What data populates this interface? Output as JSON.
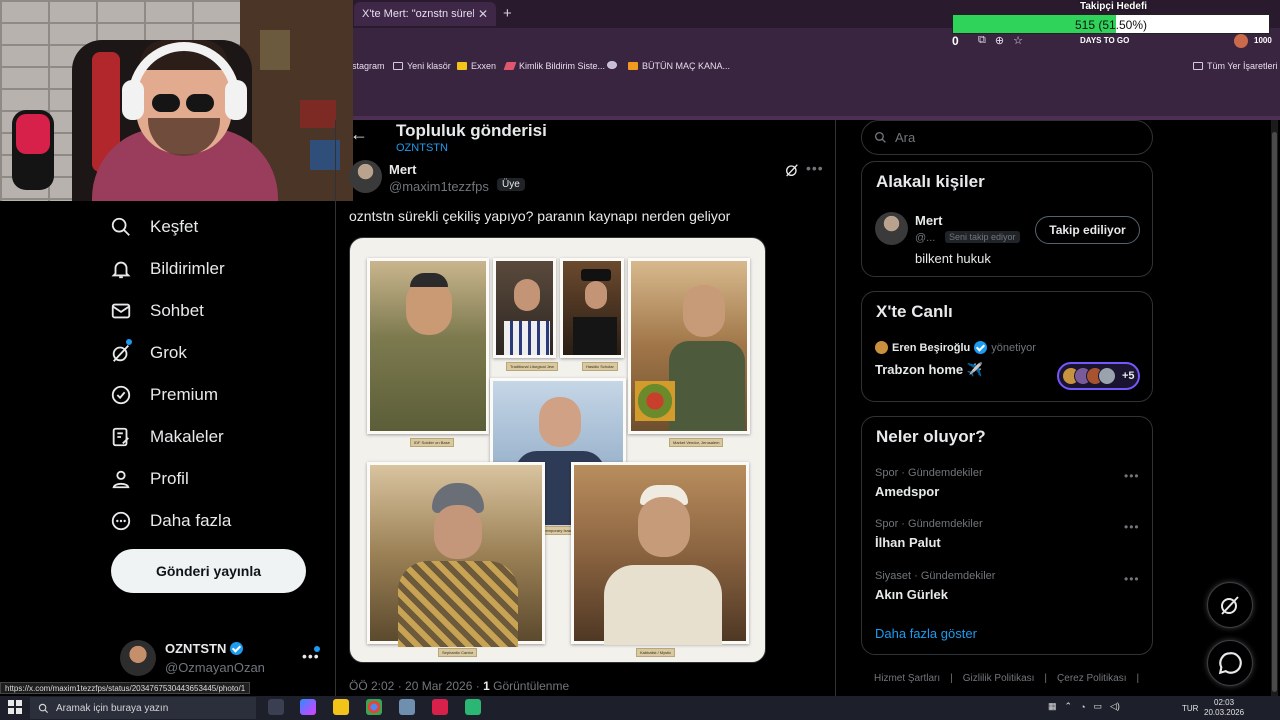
{
  "browser": {
    "tab_title": "X'te Mert: \"oznstn sürekli ç",
    "bookmarks": [
      "stagram",
      "Yeni klasör",
      "Exxen",
      "Kimlik Bildirim Siste...",
      "BÜTÜN MAÇ KANA...",
      "Tüm Yer İşaretleri"
    ],
    "toolbar_counter": "0",
    "extension_badge": "1000",
    "daysto_text": "DAYS TO GO",
    "status_url": "https://x.com/maxim1tezzfps/status/2034767530443653445/photo/1"
  },
  "goal": {
    "title": "Takipçi Hedefi",
    "text": "515 (51.50%)",
    "percent": 51.5
  },
  "nav": {
    "items": [
      "Keşfet",
      "Bildirimler",
      "Sohbet",
      "Grok",
      "Premium",
      "Makaleler",
      "Profil",
      "Daha fazla"
    ],
    "post_button": "Gönderi yayınla"
  },
  "me": {
    "name": "OZNTSTN",
    "handle": "@OzmayanOzan"
  },
  "header": {
    "title": "Topluluk gönderisi",
    "community": "OZNTSTN"
  },
  "post": {
    "author_name": "Mert",
    "author_handle": "@maxim1tezzfps",
    "badge": "Üye",
    "text": "ozntstn sürekli çekiliş yapıyo? paranın kaynapı nerden geliyor",
    "photo_labels": [
      "IDF Soldier on Base",
      "Traditional Liturgical Jew",
      "Hasidic Scholar",
      "Market Vendor, Jerusalem",
      "Contemporary Israeli Professional",
      "Sephardic Cantor",
      "Kabbalist / Mystic"
    ],
    "time": "ÖÖ 2:02 · 20 Mar 2026 ·",
    "views_count": "1",
    "views_label": "Görüntülenme"
  },
  "search": {
    "placeholder": "Ara"
  },
  "related": {
    "title": "Alakalı kişiler",
    "name": "Mert",
    "handle": "@...",
    "follows_you": "Seni takip ediyor",
    "bio": "bilkent hukuk",
    "follow_button": "Takip ediliyor"
  },
  "live": {
    "title": "X'te Canlı",
    "host": "Eren Beşiroğlu",
    "role": "yönetiyor",
    "topic": "Trabzon home ✈️",
    "more_count": "+5"
  },
  "trends": {
    "title": "Neler oluyor?",
    "items": [
      {
        "category": "Spor · Gündemdekiler",
        "name": "Amedspor"
      },
      {
        "category": "Spor · Gündemdekiler",
        "name": "İlhan Palut"
      },
      {
        "category": "Siyaset · Gündemdekiler",
        "name": "Akın Gürlek"
      }
    ],
    "show_more": "Daha fazla göster"
  },
  "footer": [
    "Hizmet Şartları",
    "Gizlilik Politikası",
    "Çerez Politikası"
  ],
  "taskbar": {
    "search_placeholder": "Aramak için buraya yazın",
    "lang": "TUR",
    "time": "02:03",
    "date": "20.03.2026"
  },
  "colors": {
    "accent": "#1d9bf0",
    "background": "#000000",
    "chrome": "#3a2540",
    "goal_fill": "#2fd35a"
  }
}
